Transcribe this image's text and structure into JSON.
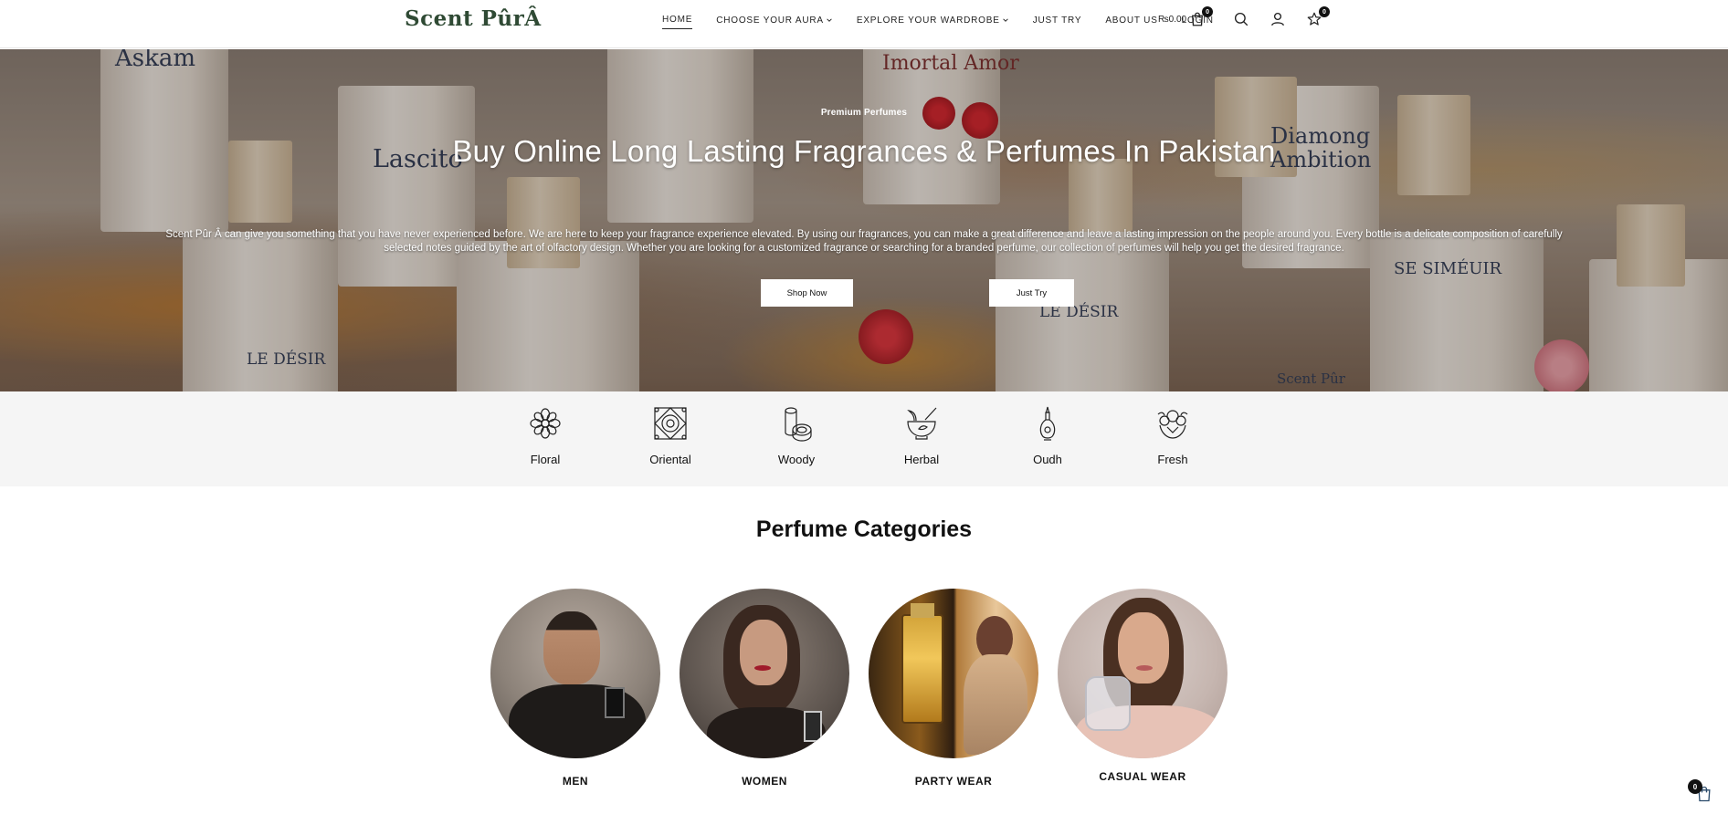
{
  "header": {
    "logo": "Scent PûrÂ",
    "nav": [
      {
        "label": "HOME",
        "active": true,
        "dropdown": false
      },
      {
        "label": "CHOOSE YOUR AURA",
        "active": false,
        "dropdown": true
      },
      {
        "label": "EXPLORE YOUR WARDROBE",
        "active": false,
        "dropdown": true
      },
      {
        "label": "JUST TRY",
        "active": false,
        "dropdown": false
      },
      {
        "label": "ABOUT US",
        "active": false,
        "dropdown": false
      },
      {
        "label": "LOGIN",
        "active": false,
        "dropdown": false
      }
    ],
    "cart_price": "₨0.00",
    "cart_count": "0",
    "wishlist_count": "0"
  },
  "hero": {
    "eyebrow": "Premium Perfumes",
    "headline": "Buy Online Long Lasting Fragrances & Perfumes In Pakistan",
    "description": "Scent Pûr Â can give you something that you have never experienced before. We are here to keep your fragrance experience elevated. By using our fragrances, you can make a great difference and leave a lasting impression on the people around you. Every bottle is a delicate composition of carefully selected notes guided by the art of olfactory design. Whether you are looking for a customized fragrance or searching for a branded perfume, our collection of perfumes will help you get the desired fragrance.",
    "shop_now": "Shop Now",
    "just_try": "Just Try",
    "bottle_labels": [
      "Askam",
      "Lascito",
      "Imortal Amor",
      "Diamong Ambition",
      "LE DÉSIR",
      "LE DÉSIR",
      "SE SIMÉUIR",
      "Scent Pûr"
    ]
  },
  "fragrance_types": [
    {
      "label": "Floral",
      "icon": "flower-icon"
    },
    {
      "label": "Oriental",
      "icon": "oriental-pattern-icon"
    },
    {
      "label": "Woody",
      "icon": "wood-log-icon"
    },
    {
      "label": "Herbal",
      "icon": "mortar-herb-icon"
    },
    {
      "label": "Oudh",
      "icon": "oud-bottle-icon"
    },
    {
      "label": "Fresh",
      "icon": "fresh-bouquet-icon"
    }
  ],
  "categories": {
    "title": "Perfume Categories",
    "items": [
      {
        "label": "MEN"
      },
      {
        "label": "WOMEN"
      },
      {
        "label": "PARTY WEAR"
      },
      {
        "label": "CASUAL WEAR"
      }
    ]
  },
  "floating_cart": {
    "count": "0"
  },
  "colors": {
    "logo": "#2f4a34",
    "hero_text": "#ffffff",
    "types_bg": "#f5f5f5"
  }
}
